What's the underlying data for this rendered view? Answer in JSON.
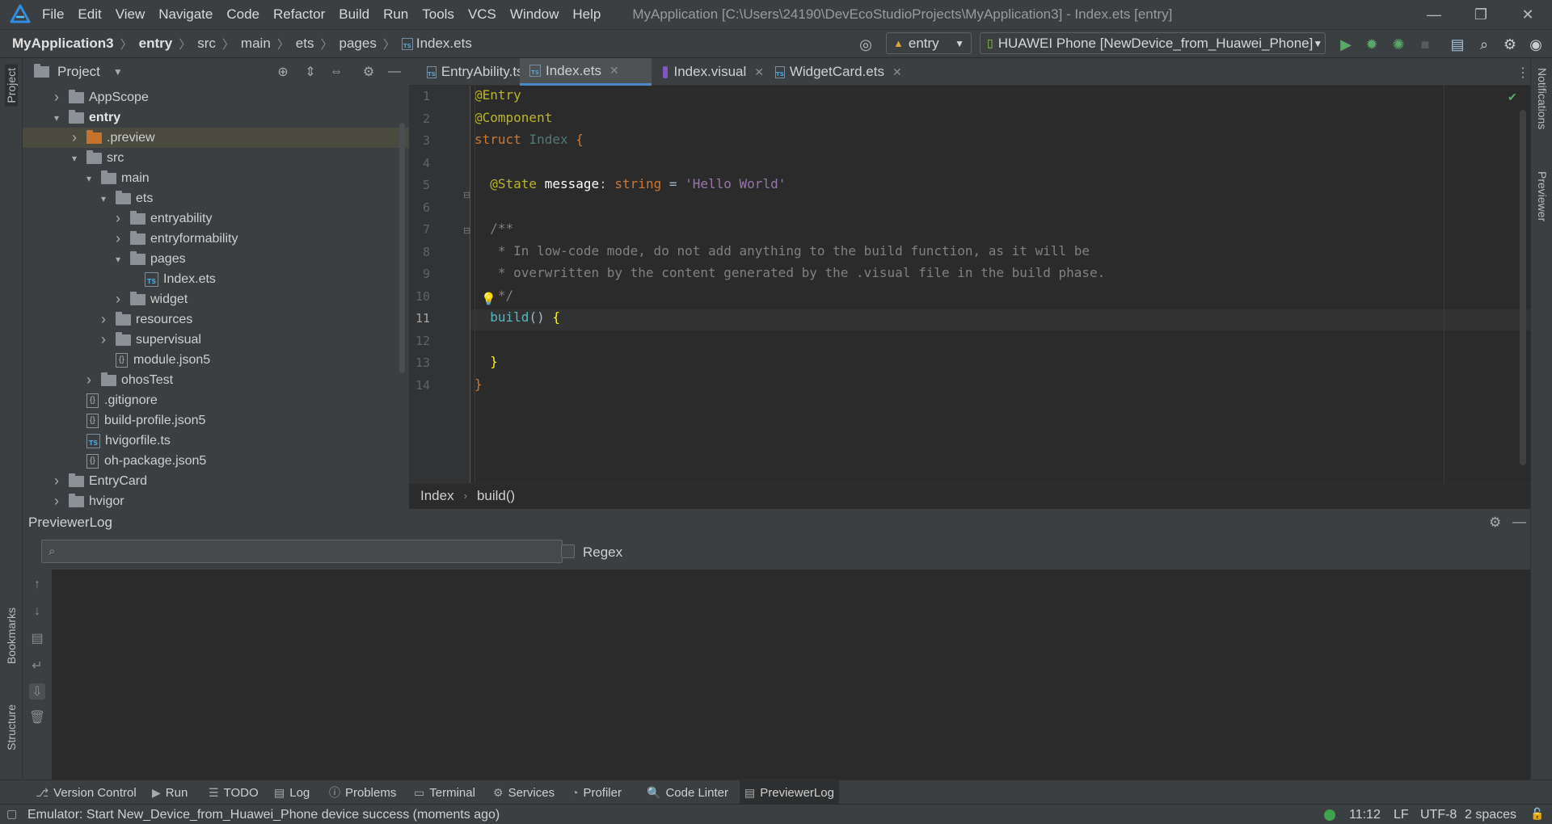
{
  "menu": [
    "File",
    "Edit",
    "View",
    "Navigate",
    "Code",
    "Refactor",
    "Build",
    "Run",
    "Tools",
    "VCS",
    "Window",
    "Help"
  ],
  "window_title": "MyApplication [C:\\Users\\24190\\DevEcoStudioProjects\\MyApplication3] - Index.ets [entry]",
  "breadcrumb": [
    "MyApplication3",
    "entry",
    "src",
    "main",
    "ets",
    "pages",
    "Index.ets"
  ],
  "toolbar": {
    "module_combo": "entry",
    "device_combo": "HUAWEI Phone [NewDevice_from_Huawei_Phone]"
  },
  "project_panel": {
    "title": "Project",
    "tree": [
      {
        "label": "AppScope",
        "kind": "folder",
        "arrow": "right"
      },
      {
        "label": "entry",
        "kind": "folder",
        "arrow": "down",
        "bold": true
      },
      {
        "label": ".preview",
        "kind": "folder-orange",
        "arrow": "right",
        "selected": true
      },
      {
        "label": "src",
        "kind": "folder",
        "arrow": "down"
      },
      {
        "label": "main",
        "kind": "folder",
        "arrow": "down"
      },
      {
        "label": "ets",
        "kind": "folder",
        "arrow": "down"
      },
      {
        "label": "entryability",
        "kind": "folder",
        "arrow": "right"
      },
      {
        "label": "entryformability",
        "kind": "folder",
        "arrow": "right"
      },
      {
        "label": "pages",
        "kind": "folder",
        "arrow": "down"
      },
      {
        "label": "Index.ets",
        "kind": "ts",
        "arrow": ""
      },
      {
        "label": "widget",
        "kind": "folder",
        "arrow": "right"
      },
      {
        "label": "resources",
        "kind": "folder",
        "arrow": "right"
      },
      {
        "label": "supervisual",
        "kind": "folder",
        "arrow": "right"
      },
      {
        "label": "module.json5",
        "kind": "json",
        "arrow": ""
      },
      {
        "label": "ohosTest",
        "kind": "folder",
        "arrow": "right"
      },
      {
        "label": ".gitignore",
        "kind": "json",
        "arrow": ""
      },
      {
        "label": "build-profile.json5",
        "kind": "json",
        "arrow": ""
      },
      {
        "label": "hvigorfile.ts",
        "kind": "ts",
        "arrow": ""
      },
      {
        "label": "oh-package.json5",
        "kind": "json",
        "arrow": ""
      },
      {
        "label": "EntryCard",
        "kind": "folder",
        "arrow": "right"
      },
      {
        "label": "hvigor",
        "kind": "folder",
        "arrow": "right"
      }
    ]
  },
  "editor_tabs": [
    {
      "label": "EntryAbility.ts",
      "icon": "ts"
    },
    {
      "label": "Index.ets",
      "icon": "ts",
      "active": true
    },
    {
      "label": "Index.visual",
      "icon": "visual"
    },
    {
      "label": "WidgetCard.ets",
      "icon": "ts"
    }
  ],
  "code_lines": [
    {
      "n": "1",
      "segs": [
        [
          "@Entry",
          "#bbb529"
        ]
      ]
    },
    {
      "n": "2",
      "segs": [
        [
          "@Component",
          "#bbb529"
        ]
      ]
    },
    {
      "n": "3",
      "segs": [
        [
          "struct ",
          "#cc7832"
        ],
        [
          "Index",
          "#507874"
        ],
        [
          " {",
          "#cc7832"
        ]
      ]
    },
    {
      "n": "4",
      "segs": []
    },
    {
      "n": "5",
      "segs": [
        [
          "  @State ",
          "#bbb529"
        ],
        [
          "message",
          "#ffffff"
        ],
        [
          ": ",
          "#a9b7c6"
        ],
        [
          "string",
          "#cc7832"
        ],
        [
          " = ",
          "#a9b7c6"
        ],
        [
          "'Hello World'",
          "#9876aa"
        ]
      ]
    },
    {
      "n": "6",
      "segs": []
    },
    {
      "n": "7",
      "segs": [
        [
          "  /**",
          "#808080"
        ]
      ]
    },
    {
      "n": "8",
      "segs": [
        [
          "   * In low-code mode, do not add anything to the build function, as it will be",
          "#808080"
        ]
      ]
    },
    {
      "n": "9",
      "segs": [
        [
          "   * overwritten by the content generated by the .visual file in the build phase.",
          "#808080"
        ]
      ]
    },
    {
      "n": "10",
      "segs": [
        [
          "   */",
          "#808080"
        ]
      ]
    },
    {
      "n": "11",
      "segs": [
        [
          "  build",
          "#56b6c2"
        ],
        [
          "() ",
          "#a9b7c6"
        ],
        [
          "{",
          "#ffef28"
        ]
      ]
    },
    {
      "n": "12",
      "segs": []
    },
    {
      "n": "13",
      "segs": [
        [
          "  }",
          "#ffef28"
        ]
      ]
    },
    {
      "n": "14",
      "segs": [
        [
          "}",
          "#cc7832"
        ]
      ]
    }
  ],
  "editor_breadcrumb": [
    "Index",
    "build()"
  ],
  "previewer_log": {
    "title": "PreviewerLog",
    "search_placeholder": "",
    "regex_label": "Regex"
  },
  "bottom_tabs": [
    "Version Control",
    "Run",
    "TODO",
    "Log",
    "Problems",
    "Terminal",
    "Services",
    "Profiler",
    "Code Linter",
    "PreviewerLog"
  ],
  "status": {
    "message": "Emulator: Start New_Device_from_Huawei_Phone device success (moments ago)",
    "position": "11:12",
    "line_sep": "LF",
    "encoding": "UTF-8",
    "indent": "2 spaces"
  },
  "side_labels": {
    "project": "Project",
    "bookmarks": "Bookmarks",
    "structure": "Structure",
    "notifications": "Notifications",
    "previewer": "Previewer"
  }
}
